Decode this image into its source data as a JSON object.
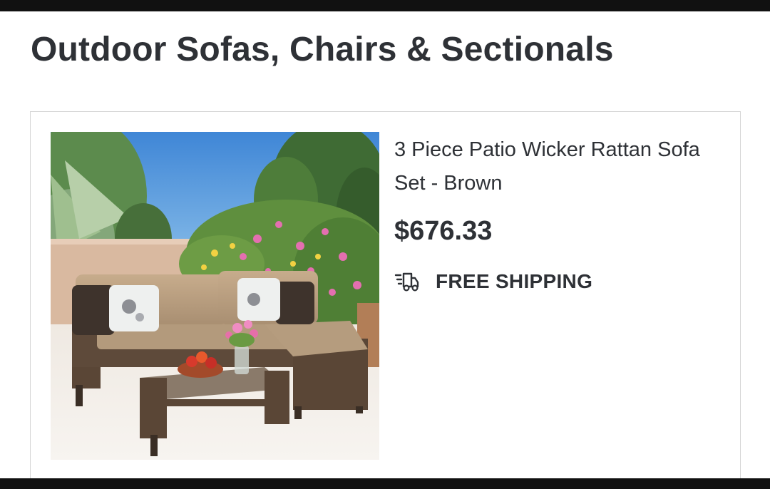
{
  "page": {
    "title": "Outdoor Sofas, Chairs & Sectionals"
  },
  "product": {
    "name": "3 Piece Patio Wicker Rattan Sofa Set - Brown",
    "price": "$676.33",
    "shipping_label": "FREE SHIPPING",
    "shipping_icon": "fast-delivery-truck-icon",
    "image": "patio-wicker-sofa-set-photo"
  },
  "colors": {
    "text": "#2e3136",
    "frame_bar": "#111111",
    "card_border": "#d6d6d6"
  }
}
